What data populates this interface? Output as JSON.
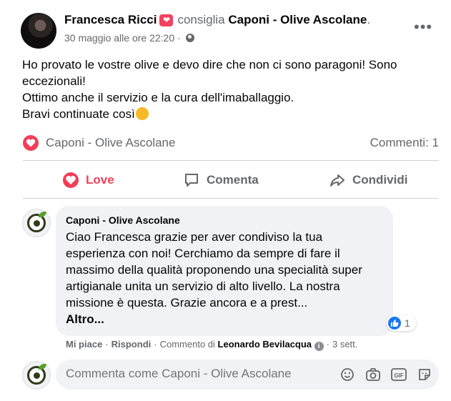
{
  "post": {
    "author": "Francesca Ricci",
    "recommends_text": "consiglia",
    "page_name": "Caponi - Olive Ascolane",
    "page_name_suffix": ".",
    "timestamp": "30 maggio alle ore 22:20 ·",
    "text_lines": [
      "Ho provato le vostre olive e devo dire che non ci sono paragoni! Sono eccezionali!",
      "Ottimo anche il servizio e la cura dell'imaballaggio.",
      "Bravi continuate così"
    ]
  },
  "reactions": {
    "reactor": "Caponi - Olive Ascolane",
    "comments_count": "Commenti: 1"
  },
  "actions": {
    "love": "Love",
    "comment": "Comenta",
    "share": "Condividi"
  },
  "comment": {
    "author": "Caponi - Olive Ascolane",
    "text": "Ciao Francesca grazie per aver condiviso la tua esperienza con noi! Cerchiamo da sempre di fare il massimo della qualità proponendo una specialità super artigianale unita un servizio di alto livello. La nostra missione è questa. Grazie ancora e a prest...",
    "more": "Altro...",
    "like_count": "1",
    "like_label": "Mi piace",
    "reply_label": "Rispondi",
    "comment_by_label": "Commento di",
    "comment_by": "Leonardo Bevilacqua",
    "age": "3 sett."
  },
  "composer": {
    "placeholder": "Commenta come Caponi - Olive Ascolane"
  },
  "colors": {
    "love": "#f33e58",
    "like": "#1877f2",
    "muted": "#65676b"
  }
}
